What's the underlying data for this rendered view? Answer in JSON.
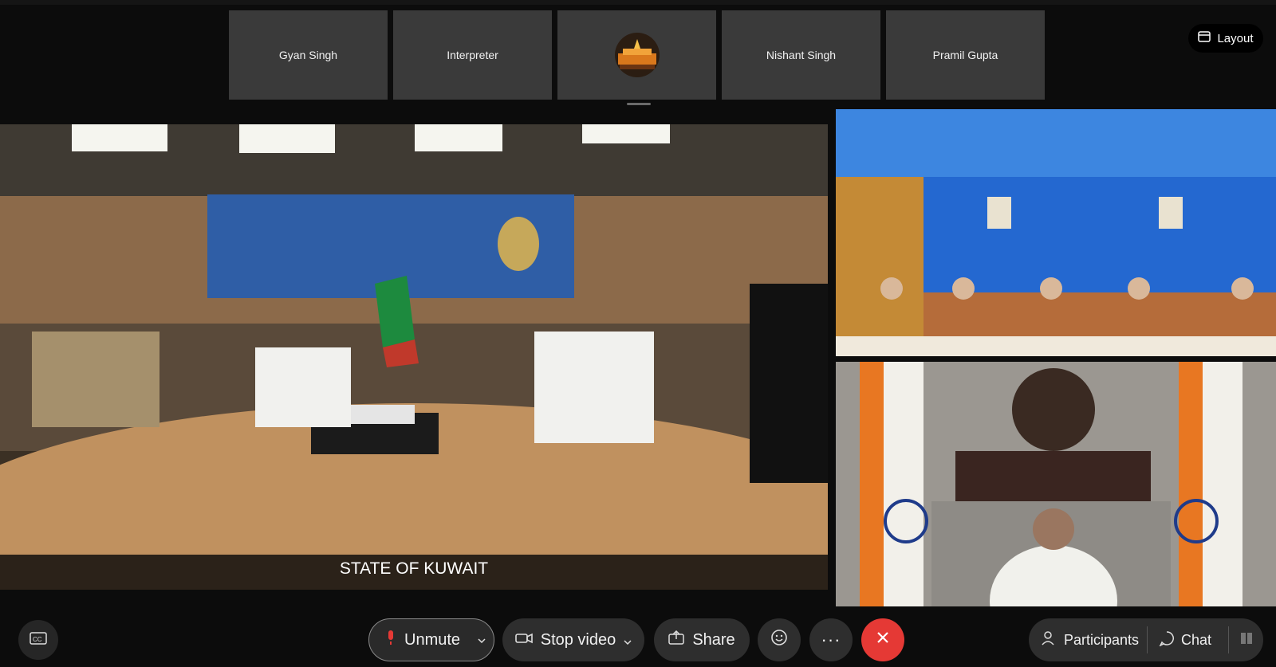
{
  "participants_strip": [
    {
      "name": "Gyan Singh"
    },
    {
      "name": "Interpreter"
    },
    {
      "name": ""
    },
    {
      "name": "Nishant Singh"
    },
    {
      "name": "Pramil Gupta"
    }
  ],
  "layout_button": {
    "label": "Layout",
    "icon": "layout-icon"
  },
  "main_video": {
    "label": "STATE OF KUWAIT"
  },
  "toolbar": {
    "captions_icon": "closed-captions-icon",
    "unmute_label": "Unmute",
    "stop_video_label": "Stop video",
    "share_label": "Share",
    "reactions_icon": "emoji-icon",
    "more_icon": "more-icon",
    "leave_icon": "close-icon",
    "participants_label": "Participants",
    "chat_label": "Chat",
    "leave_color": "#e53935",
    "unmute_mic_color": "#e53935"
  }
}
